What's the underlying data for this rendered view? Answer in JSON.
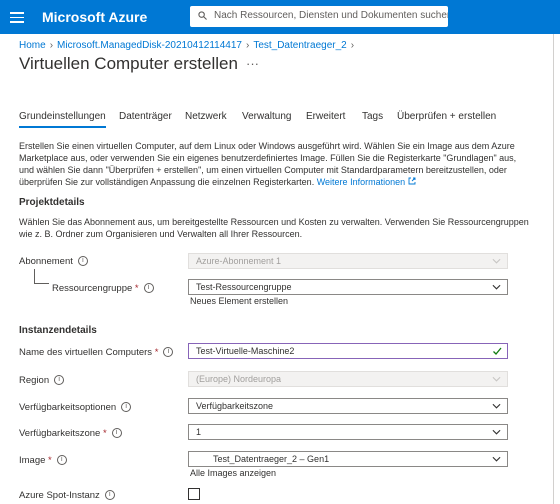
{
  "topbar": {
    "brand": "Microsoft Azure",
    "search_placeholder": "Nach Ressourcen, Diensten und Dokumenten suchen (G+/)"
  },
  "breadcrumb": [
    "Home",
    "Microsoft.ManagedDisk-20210412114417",
    "Test_Datentraeger_2"
  ],
  "page": {
    "title": "Virtuellen Computer erstellen",
    "more": "···"
  },
  "tabs": [
    "Grundeinstellungen",
    "Datenträger",
    "Netzwerk",
    "Verwaltung",
    "Erweitert",
    "Tags",
    "Überprüfen + erstellen"
  ],
  "intro": {
    "text": "Erstellen Sie einen virtuellen Computer, auf dem Linux oder Windows ausgeführt wird. Wählen Sie ein Image aus dem Azure Marketplace aus, oder verwenden Sie ein eigenes benutzerdefiniertes Image. Füllen Sie die Registerkarte \"Grundlagen\" aus, und wählen Sie dann \"Überprüfen + erstellen\", um einen virtuellen Computer mit Standardparametern bereitzustellen, oder überprüfen Sie zur vollständigen Anpassung die einzelnen Registerkarten.",
    "link": "Weitere Informationen"
  },
  "projekt": {
    "heading": "Projektdetails",
    "text": "Wählen Sie das Abonnement aus, um bereitgestellte Ressourcen und Kosten zu verwalten. Verwenden Sie Ressourcengruppen wie z. B. Ordner zum Organisieren und Verwalten all Ihrer Ressourcen.",
    "abo_label": "Abonnement",
    "abo_value": "Azure-Abonnement 1",
    "rg_label": "Ressourcengruppe",
    "rg_value": "Test-Ressourcengruppe",
    "rg_new": "Neues Element erstellen"
  },
  "instanz": {
    "heading": "Instanzendetails",
    "name_label": "Name des virtuellen Computers",
    "name_value": "Test-Virtuelle-Maschine2",
    "region_label": "Region",
    "region_value": "(Europe) Nordeuropa",
    "opt_label": "Verfügbarkeitsoptionen",
    "opt_value": "Verfügbarkeitszone",
    "zone_label": "Verfügbarkeitszone",
    "zone_value": "1",
    "image_label": "Image",
    "image_value": "Test_Datentraeger_2 – Gen1",
    "image_link": "Alle Images anzeigen",
    "spot_label": "Azure Spot-Instanz"
  },
  "colors": {
    "accent": "#0078d4",
    "required": "#a4262c",
    "valid": "#107c10",
    "focus": "#8764b8"
  }
}
